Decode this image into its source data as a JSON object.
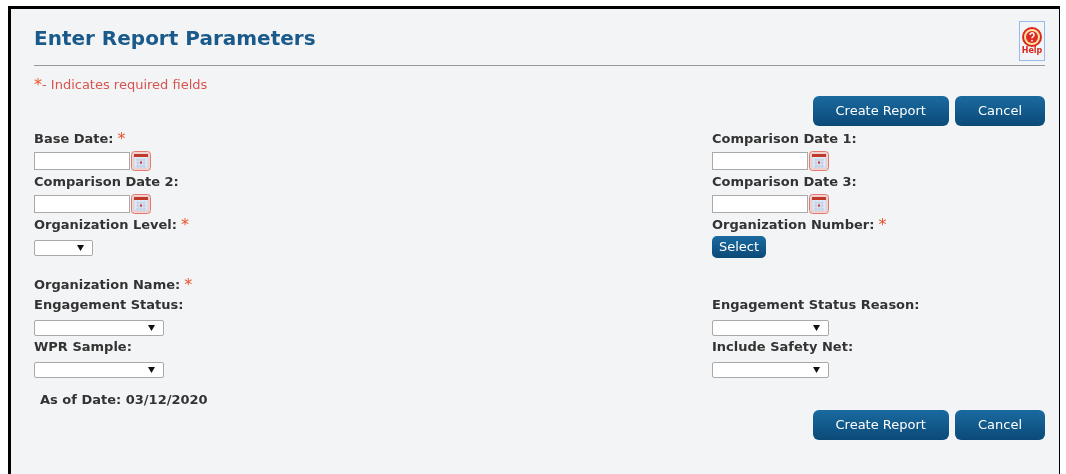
{
  "title": "Enter Report Parameters",
  "help": {
    "label": "Help"
  },
  "required_note": {
    "mark": "*",
    "text": "- Indicates required fields"
  },
  "top_buttons": [
    "Create Report",
    "Cancel"
  ],
  "rows": [
    [
      {
        "label": "Base Date:",
        "required": true,
        "kind": "date"
      },
      {
        "label": "Comparison Date 1:",
        "required": false,
        "kind": "date"
      }
    ],
    [
      {
        "label": "Comparison Date 2:",
        "required": false,
        "kind": "date"
      },
      {
        "label": "Comparison Date 3:",
        "required": false,
        "kind": "date"
      }
    ],
    [
      {
        "label": "Organization Level:",
        "required": true,
        "kind": "short_select"
      },
      {
        "label": "Organization Number:",
        "required": true,
        "kind": "button",
        "button": "Select"
      }
    ],
    [
      {
        "label": "Organization Name:",
        "required": true,
        "kind": "none"
      },
      null
    ],
    [
      {
        "label": "Engagement Status:",
        "required": false,
        "kind": "select"
      },
      {
        "label": "Engagement Status Reason:",
        "required": false,
        "kind": "select"
      }
    ],
    [
      {
        "label": "WPR Sample:",
        "required": false,
        "kind": "select"
      },
      {
        "label": "Include Safety Net:",
        "required": false,
        "kind": "select"
      }
    ]
  ],
  "as_of": "As of Date: 03/12/2020",
  "bottom_buttons": [
    "Create Report",
    "Cancel"
  ]
}
